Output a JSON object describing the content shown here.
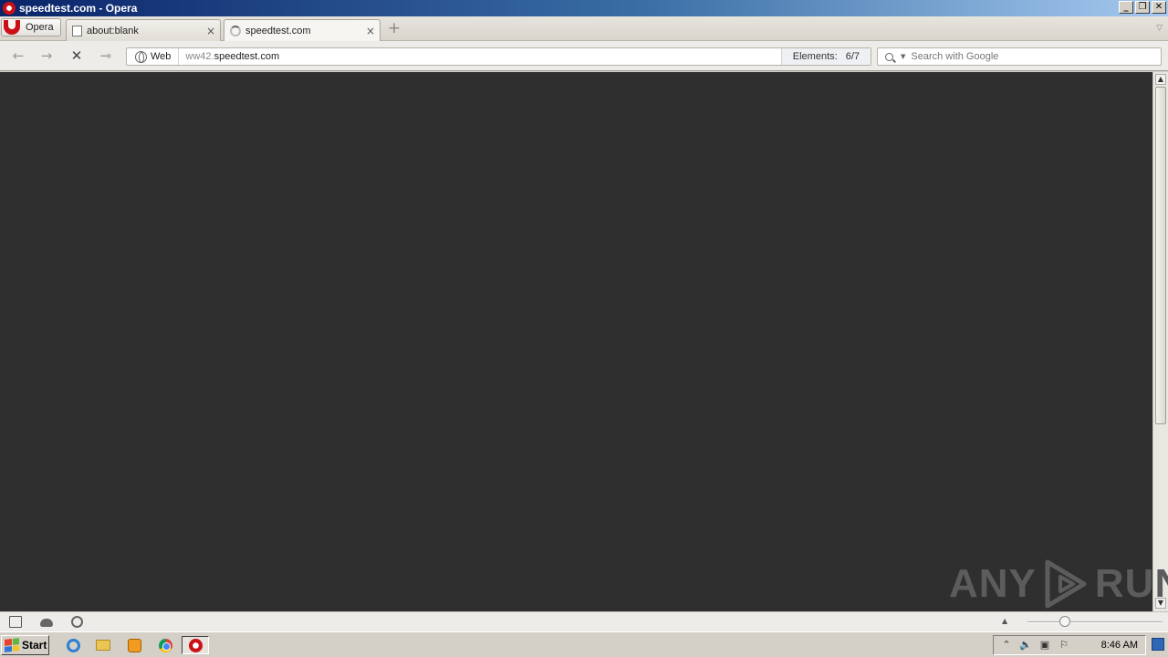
{
  "window": {
    "title": "speedtest.com - Opera"
  },
  "menu": {
    "label": "Opera"
  },
  "tabs": [
    {
      "label": "about:blank",
      "close": "×",
      "active": false
    },
    {
      "label": "speedtest.com",
      "close": "×",
      "active": true
    }
  ],
  "new_tab": "+",
  "toolbar": {
    "back": "←",
    "forward": "→",
    "stop": "✕",
    "key": "⊸"
  },
  "address": {
    "badge": "Web",
    "url_sub": "ww42.",
    "url_domain": "speedtest.com",
    "elements_label": "Elements:",
    "elements_value": "6/7"
  },
  "search": {
    "placeholder": "Search with Google"
  },
  "scroll": {
    "up": "▲",
    "down": "▼"
  },
  "watermark": {
    "left": "ANY",
    "right": "RUN"
  },
  "statusbar": {
    "zoom_arrow": "▲"
  },
  "taskbar": {
    "start": "Start",
    "clock": "8:46 AM"
  },
  "colors": {
    "content_bg": "#2f2f2f",
    "opera_red": "#cc0f16",
    "titlebar_start": "#0a246a",
    "titlebar_end": "#a6caf0"
  }
}
